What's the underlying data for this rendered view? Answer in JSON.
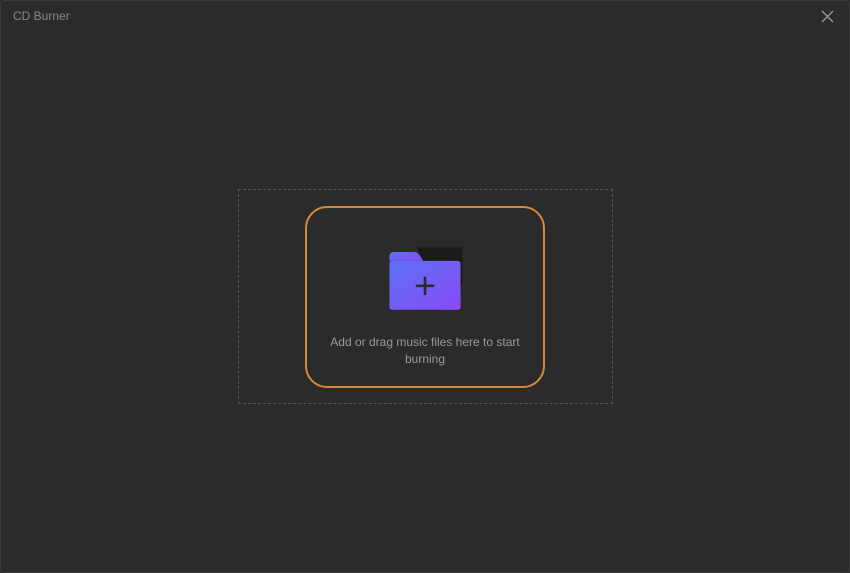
{
  "window": {
    "title": "CD Burner"
  },
  "dropzone": {
    "instruction": "Add or drag music files here to start burning"
  }
}
